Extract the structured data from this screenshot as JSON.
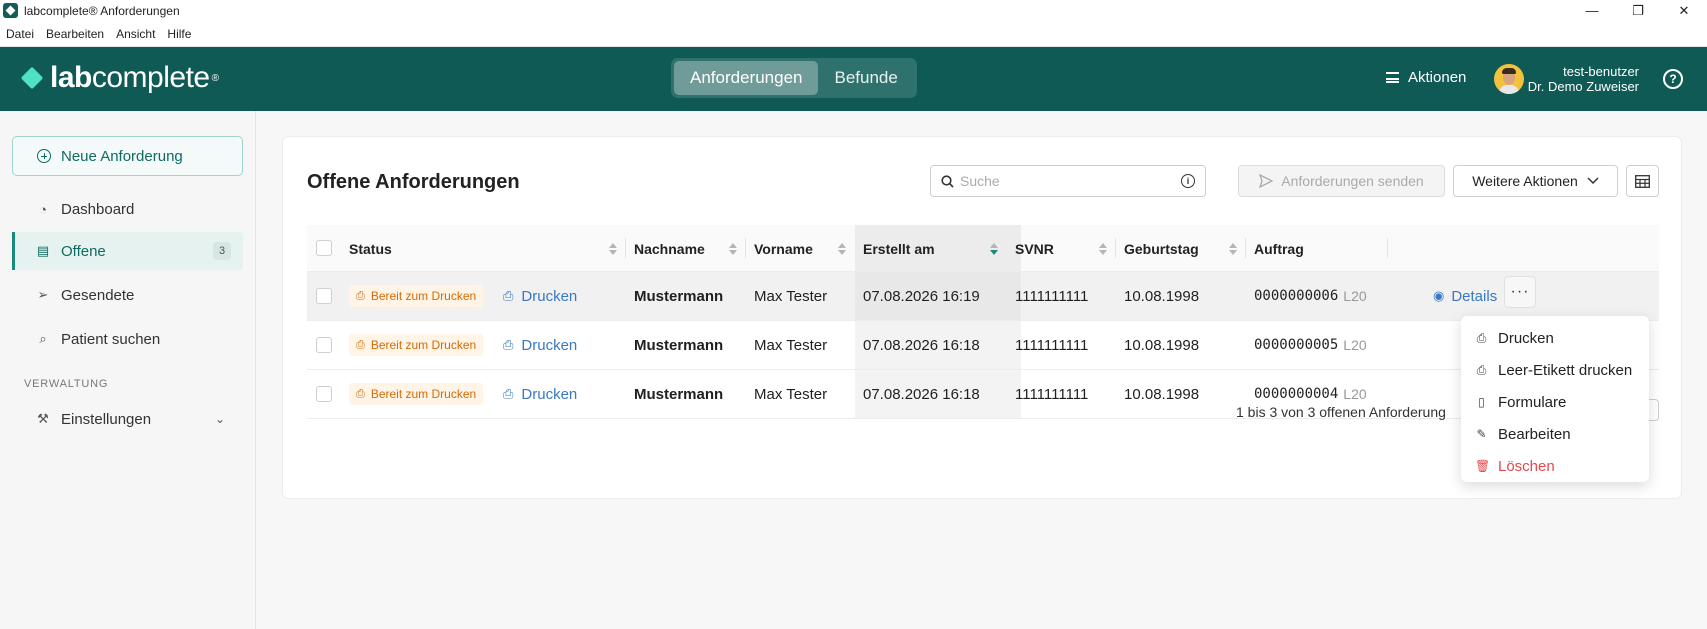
{
  "window": {
    "title": "labcomplete® Anforderungen",
    "minimize": "—",
    "restore": "❐",
    "close": "✕"
  },
  "menubar": [
    "Datei",
    "Bearbeiten",
    "Ansicht",
    "Hilfe"
  ],
  "header": {
    "logo_bold": "lab",
    "logo_rest": "complete",
    "logo_mark": "®",
    "tabs": [
      "Anforderungen",
      "Befunde"
    ],
    "active_tab": "Anforderungen",
    "actions_label": "Aktionen",
    "user_name": "test-benutzer",
    "user_role": "Dr. Demo Zuweiser",
    "help_icon": "?"
  },
  "sidebar": {
    "new_button": "Neue Anforderung",
    "items": [
      {
        "label": "Dashboard",
        "icon": "dashboard-icon"
      },
      {
        "label": "Offene",
        "icon": "clipboard-icon",
        "badge": "3",
        "active": true
      },
      {
        "label": "Gesendete",
        "icon": "send-icon"
      },
      {
        "label": "Patient suchen",
        "icon": "search-icon"
      }
    ],
    "section_label": "VERWALTUNG",
    "settings_label": "Einstellungen"
  },
  "main": {
    "title": "Offene Anforderungen",
    "search_placeholder": "Suche",
    "send_button": "Anforderungen senden",
    "more_button": "Weitere Aktionen",
    "columns": [
      "Status",
      "Nachname",
      "Vorname",
      "Erstellt am",
      "SVNR",
      "Geburtstag",
      "Auftrag"
    ],
    "sorted_column": "Erstellt am",
    "rows": [
      {
        "status": "Bereit zum Drucken",
        "print": "Drucken",
        "nachname": "Mustermann",
        "vorname": "Max Tester",
        "erstellt": "07.08.2026 16:19",
        "svnr": "1111111111",
        "geburtstag": "10.08.1998",
        "auftrag": "0000000006",
        "tag": "L20",
        "details": "Details"
      },
      {
        "status": "Bereit zum Drucken",
        "print": "Drucken",
        "nachname": "Mustermann",
        "vorname": "Max Tester",
        "erstellt": "07.08.2026 16:18",
        "svnr": "1111111111",
        "geburtstag": "10.08.1998",
        "auftrag": "0000000005",
        "tag": "L20"
      },
      {
        "status": "Bereit zum Drucken",
        "print": "Drucken",
        "nachname": "Mustermann",
        "vorname": "Max Tester",
        "erstellt": "07.08.2026 16:18",
        "svnr": "1111111111",
        "geburtstag": "10.08.1998",
        "auftrag": "0000000004",
        "tag": "L20"
      }
    ],
    "pager_text": "1 bis 3 von 3 offenen Anforderung"
  },
  "context_menu": {
    "items": [
      {
        "label": "Drucken",
        "icon": "printer-icon"
      },
      {
        "label": "Leer-Etikett drucken",
        "icon": "printer-icon"
      },
      {
        "label": "Formulare",
        "icon": "document-icon"
      },
      {
        "label": "Bearbeiten",
        "icon": "pencil-icon"
      },
      {
        "label": "Löschen",
        "icon": "trash-icon",
        "danger": true
      }
    ]
  },
  "colors": {
    "header_bg": "#0f5a55",
    "accent": "#1a8a7c",
    "link": "#3a78c2",
    "status_text": "#d46b08",
    "status_bg": "#fff4e5",
    "danger": "#e5484d"
  }
}
